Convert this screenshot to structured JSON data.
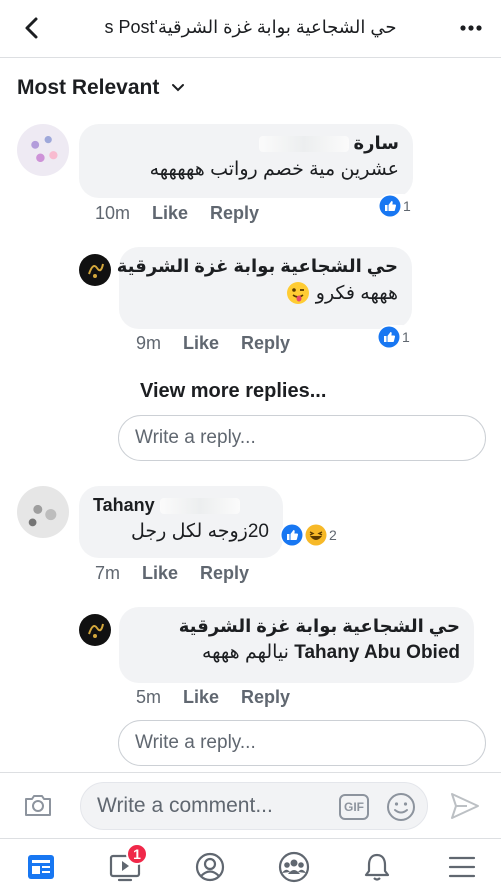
{
  "header": {
    "title": "حي الشجاعية بوابة غزة الشرقية's Post",
    "back_icon": "chevron-left-icon",
    "more_icon": "more-dots-icon"
  },
  "sort": {
    "label": "Most Relevant",
    "icon": "chevron-down-icon"
  },
  "comments": [
    {
      "name": "سارة",
      "text": "عشرين مية خصم رواتب هههههه",
      "time": "10m",
      "like_label": "Like",
      "reply_label": "Reply",
      "reaction_count": "1",
      "replies": [
        {
          "name": "حي الشجاعية بوابة غزة الشرقية",
          "text": "هههه فكرو",
          "time": "9m",
          "like_label": "Like",
          "reply_label": "Reply",
          "reaction_count": "1"
        }
      ],
      "view_more": "View more replies...",
      "reply_placeholder": "Write a reply..."
    },
    {
      "name": "Tahany",
      "text": "20زوجه لكل رجل",
      "time": "7m",
      "like_label": "Like",
      "reply_label": "Reply",
      "reaction_count": "2",
      "replies": [
        {
          "name": "حي الشجاعية بوابة غزة الشرقية",
          "mention": "Tahany Abu Obied",
          "text": "نيالهم هههه",
          "time": "5m",
          "like_label": "Like",
          "reply_label": "Reply"
        }
      ],
      "reply_placeholder": "Write a reply..."
    }
  ],
  "composer": {
    "placeholder": "Write a comment...",
    "gif_label": "GIF",
    "camera_icon": "camera-icon",
    "emoji_icon": "emoji-icon",
    "send_icon": "send-icon"
  },
  "nav": {
    "items": [
      "news-feed-icon",
      "watch-icon",
      "profile-icon",
      "groups-icon",
      "notifications-icon",
      "menu-icon"
    ],
    "watch_badge": "1"
  },
  "colors": {
    "like_blue": "#1877f2",
    "badge_red": "#f02849",
    "bubble_gray": "#f2f3f5",
    "meta_gray": "#606770"
  }
}
